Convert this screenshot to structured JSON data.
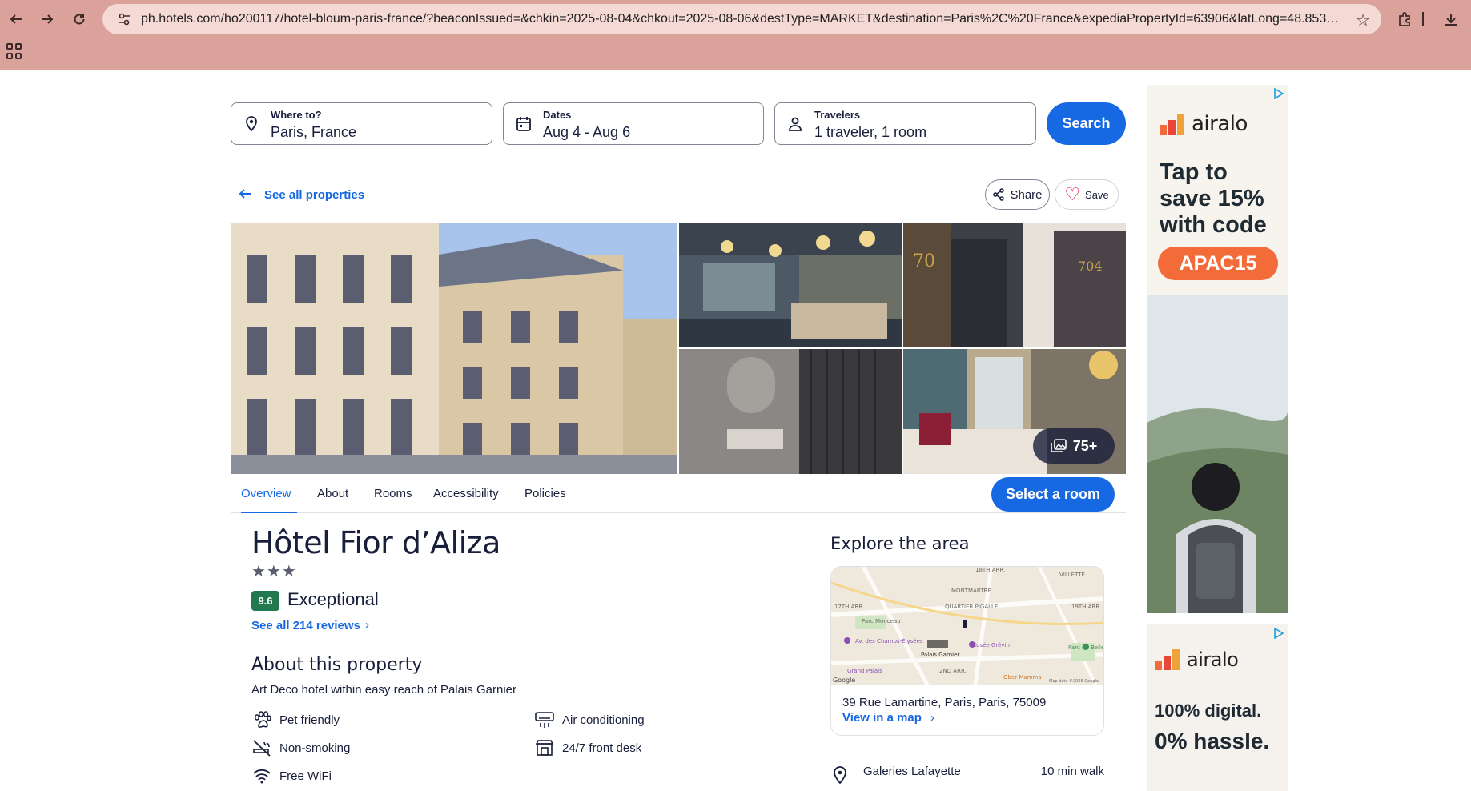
{
  "browser": {
    "url": "ph.hotels.com/ho200117/hotel-bloum-paris-france/?beaconIssued=&chkin=2025-08-04&chkout=2025-08-06&destType=MARKET&destination=Paris%2C%20France&expediaPropertyId=63906&latLong=48.853564%2C2..."
  },
  "search": {
    "where_label": "Where to?",
    "where_value": "Paris, France",
    "dates_label": "Dates",
    "dates_value": "Aug 4 - Aug 6",
    "travelers_label": "Travelers",
    "travelers_value": "1 traveler, 1 room",
    "button": "Search"
  },
  "nav": {
    "back_label": "See all properties",
    "share_label": "Share",
    "save_label": "Save"
  },
  "gallery": {
    "count_label": "75+"
  },
  "tabs": [
    "Overview",
    "About",
    "Rooms",
    "Accessibility",
    "Policies"
  ],
  "select_room_label": "Select a room",
  "hotel": {
    "name": "Hôtel Fior d’Aliza",
    "stars": "★★★",
    "star_count": 3,
    "rating": "9.6",
    "rating_word": "Exceptional",
    "reviews_link": "See all 214 reviews",
    "about_heading": "About this property",
    "about_sub": "Art Deco hotel within easy reach of Palais Garnier",
    "amenities": [
      {
        "label": "Pet friendly",
        "icon": "paw-icon"
      },
      {
        "label": "Air conditioning",
        "icon": "ac-icon"
      },
      {
        "label": "Non-smoking",
        "icon": "no-smoking-icon"
      },
      {
        "label": "24/7 front desk",
        "icon": "front-desk-icon"
      },
      {
        "label": "Free WiFi",
        "icon": "wifi-icon"
      }
    ]
  },
  "explore": {
    "heading": "Explore the area",
    "map_labels": {
      "a": "18TH ARR.",
      "b": "VILLETTE",
      "c": "MONTMARTRE",
      "d": "17TH ARR.",
      "e": "QUARTIER PIGALLE",
      "f": "19TH ARR.",
      "g": "Parc Monceau",
      "h": "Av. des Champs-Élysées",
      "i": "Musée Grévin",
      "j": "Parc de Belleville",
      "k": "Palais Garnier",
      "l": "Grand Palais",
      "m": "2ND ARR.",
      "n": "Ober Mamma",
      "o": "Google",
      "p": "Map data ©2025 Google"
    },
    "address": "39 Rue Lamartine, Paris, Paris, 75009",
    "map_link": "View in a map",
    "poi_name": "Galeries Lafayette",
    "poi_distance": "10 min walk"
  },
  "ads": {
    "brand": "airalo",
    "ad1_headline_1": "Tap to",
    "ad1_headline_2": "save 15%",
    "ad1_headline_3": "with code",
    "ad1_code": "APAC15",
    "ad2_line1": "100% digital.",
    "ad2_line2": "0% hassle."
  },
  "colors": {
    "browser_bar": "#dba29b",
    "primary": "#1668e3",
    "rating": "#227950",
    "ad_accent": "#f46b3a"
  }
}
